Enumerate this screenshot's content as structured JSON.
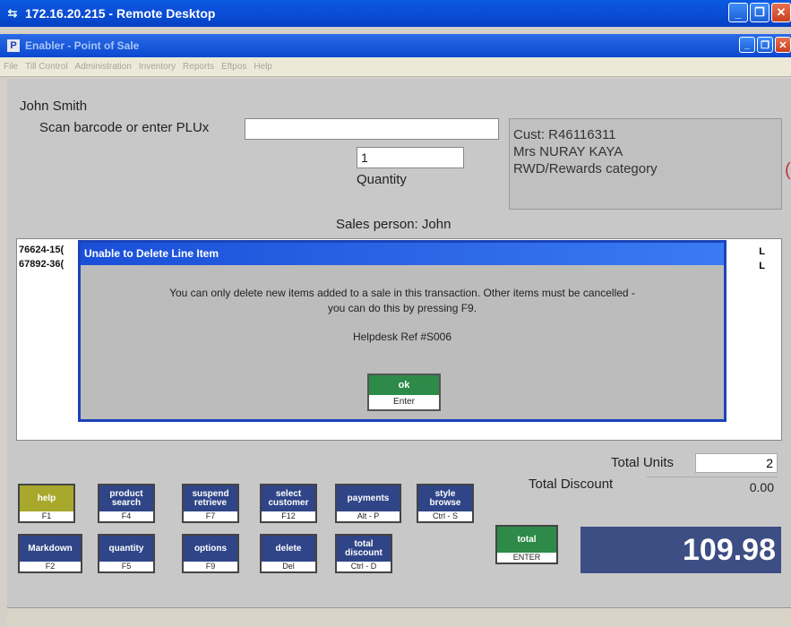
{
  "remote_desktop": {
    "title": "172.16.20.215 - Remote Desktop"
  },
  "app": {
    "title": "Enabler - Point of Sale"
  },
  "menu": [
    "File",
    "Till Control",
    "Administration",
    "Inventory",
    "Reports",
    "Eftpos",
    "Help"
  ],
  "user_name": "John Smith",
  "barcode_label": "Scan barcode or enter PLUx",
  "quantity": {
    "value": "1",
    "label": "Quantity"
  },
  "customer": {
    "line1": "Cust: R46116311",
    "line2": "Mrs NURAY KAYA",
    "line3": "RWD/Rewards category"
  },
  "sales_person": "Sales person: John",
  "items": [
    {
      "code": "76624-15(",
      "flag": "L"
    },
    {
      "code": "67892-36(",
      "flag": "L"
    }
  ],
  "dialog": {
    "title": "Unable to Delete Line Item",
    "message_line1": "You can only delete new items added to a sale in this transaction.  Other items must be cancelled -",
    "message_line2": "you can do this by pressing F9.",
    "ref": "Helpdesk Ref #S006",
    "ok_label": "ok",
    "ok_key": "Enter"
  },
  "totals": {
    "units_label": "Total Units",
    "units_value": "2",
    "discount_label": "Total Discount",
    "discount_value": "0.00",
    "amount": "109.98"
  },
  "buttons": {
    "help": {
      "label": "help",
      "key": "F1"
    },
    "product_search": {
      "label": "product search",
      "key": "F4"
    },
    "suspend_retrieve": {
      "label": "suspend retrieve",
      "key": "F7"
    },
    "select_customer": {
      "label": "select customer",
      "key": "F12"
    },
    "payments": {
      "label": "payments",
      "key": "Alt - P"
    },
    "style_browse": {
      "label": "style browse",
      "key": "Ctrl - S"
    },
    "markdown": {
      "label": "Markdown",
      "key": "F2"
    },
    "quantity": {
      "label": "quantity",
      "key": "F5"
    },
    "options": {
      "label": "options",
      "key": "F9"
    },
    "delete": {
      "label": "delete",
      "key": "Del"
    },
    "total_discount": {
      "label": "total discount",
      "key": "Ctrl - D"
    },
    "total": {
      "label": "total",
      "key": "ENTER"
    }
  },
  "colors": {
    "title_blue": "#0b4fd8",
    "button_navy": "#2f4588",
    "ok_green": "#2d8a48",
    "help_olive": "#a8a82c",
    "total_panel": "#3d4e85"
  }
}
